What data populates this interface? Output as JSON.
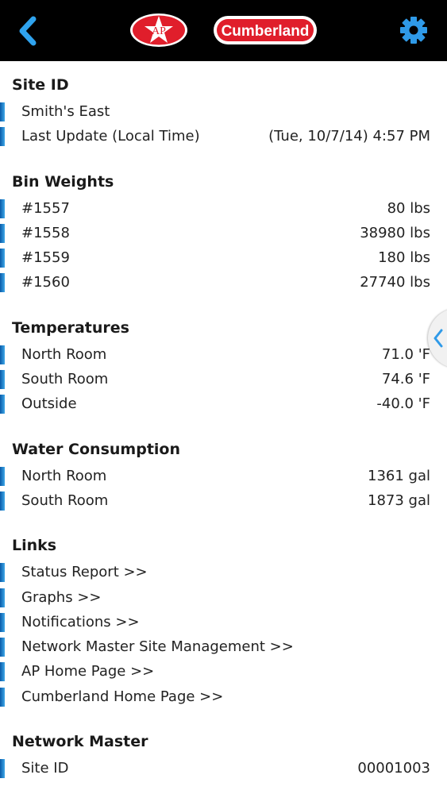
{
  "header": {
    "back_icon": "back-chevron-icon",
    "settings_icon": "gear-icon",
    "logo_ap_text": "AP",
    "logo_cumberland_text": "Cumberland",
    "colors": {
      "bar": "#000000",
      "accent": "#2c8fd6",
      "logo_red": "#e01e2b"
    }
  },
  "sections": {
    "site_id": {
      "title": "Site ID",
      "rows": [
        {
          "label": "Smith's East",
          "value": ""
        },
        {
          "label": "Last Update (Local Time)",
          "value": "(Tue, 10/7/14) 4:57 PM"
        }
      ]
    },
    "bin_weights": {
      "title": "Bin Weights",
      "rows": [
        {
          "label": "#1557",
          "value": "80 lbs"
        },
        {
          "label": "#1558",
          "value": "38980 lbs"
        },
        {
          "label": "#1559",
          "value": "180 lbs"
        },
        {
          "label": "#1560",
          "value": "27740 lbs"
        }
      ]
    },
    "temperatures": {
      "title": "Temperatures",
      "rows": [
        {
          "label": "North Room",
          "value": "71.0 'F"
        },
        {
          "label": "South Room",
          "value": "74.6 'F"
        },
        {
          "label": "Outside",
          "value": "-40.0 'F"
        }
      ]
    },
    "water": {
      "title": "Water Consumption",
      "rows": [
        {
          "label": "North Room",
          "value": "1361 gal"
        },
        {
          "label": "South Room",
          "value": "1873 gal"
        }
      ]
    },
    "links": {
      "title": "Links",
      "rows": [
        {
          "label": "Status Report >>"
        },
        {
          "label": "Graphs >>"
        },
        {
          "label": "Notifications >>"
        },
        {
          "label": "Network Master Site Management >>"
        },
        {
          "label": "AP Home Page >>"
        },
        {
          "label": "Cumberland Home Page >>"
        }
      ]
    },
    "network_master": {
      "title": "Network Master",
      "rows": [
        {
          "label": "Site ID",
          "value": "00001003"
        }
      ]
    }
  },
  "side_panel_icon": "chevron-left-icon"
}
